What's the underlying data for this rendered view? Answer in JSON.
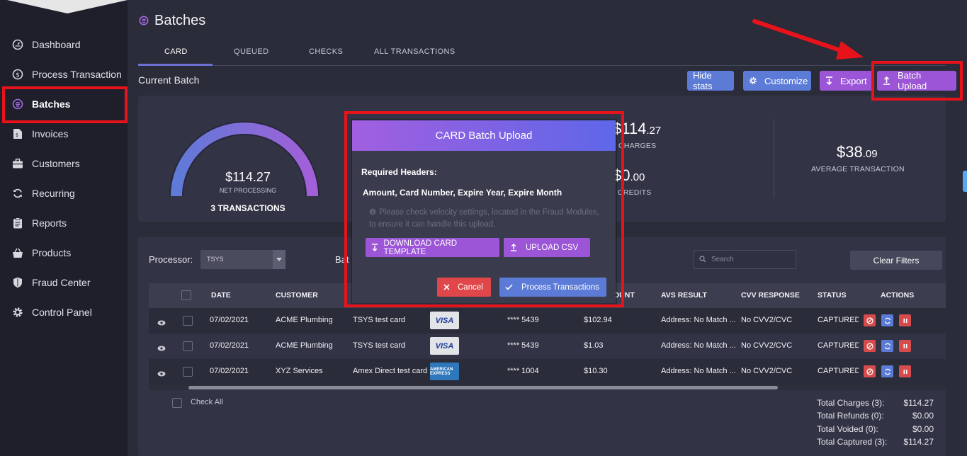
{
  "sidebar": {
    "items": [
      {
        "label": "Dashboard",
        "icon": "dashboard-gauge-icon"
      },
      {
        "label": "Process Transaction",
        "icon": "dollar-circle-icon"
      },
      {
        "label": "Batches",
        "icon": "batches-icon"
      },
      {
        "label": "Invoices",
        "icon": "invoice-icon"
      },
      {
        "label": "Customers",
        "icon": "briefcase-icon"
      },
      {
        "label": "Recurring",
        "icon": "recurring-sync-icon"
      },
      {
        "label": "Reports",
        "icon": "clipboard-icon"
      },
      {
        "label": "Products",
        "icon": "shopping-basket-icon"
      },
      {
        "label": "Fraud Center",
        "icon": "shield-icon"
      },
      {
        "label": "Control Panel",
        "icon": "gear-icon"
      }
    ],
    "active": "Batches"
  },
  "page": {
    "title": "Batches",
    "tabs": [
      "CARD",
      "QUEUED",
      "CHECKS",
      "ALL TRANSACTIONS"
    ],
    "active_tab": "CARD",
    "section_title": "Current Batch"
  },
  "toolbar": {
    "hide_stats": "Hide stats",
    "customize": "Customize",
    "export": "Export",
    "batch_upload": "Batch Upload"
  },
  "stats": {
    "gauge_amount": "$114.27",
    "gauge_label": "NET PROCESSING",
    "gauge_fill": 1.0,
    "transactions": "3 TRANSACTIONS",
    "charges_int": "$114",
    "charges_dec": ".27",
    "charges_label": "CHARGES",
    "credits_int": "$0",
    "credits_dec": ".00",
    "credits_label": "CREDITS",
    "avg_int": "$38",
    "avg_dec": ".09",
    "avg_label": "AVERAGE TRANSACTION"
  },
  "filters": {
    "processor_label": "Processor:",
    "processor_value": "TSYS",
    "batch_label": "Bat",
    "search_placeholder": "Search",
    "clear_filters": "Clear Filters"
  },
  "table": {
    "headers": {
      "date": "DATE",
      "customer": "CUSTOMER",
      "amount": "OUNT",
      "avs": "AVS RESULT",
      "cvv": "CVV RESPONSE",
      "status": "STATUS",
      "actions": "ACTIONS"
    },
    "rows": [
      {
        "date": "07/02/2021",
        "customer": "ACME Plumbing",
        "description": "TSYS test card",
        "brand": "VISA",
        "card": "**** 5439",
        "amount": "$102.94",
        "avs": "Address: No Match ...",
        "cvv": "No CVV2/CVC",
        "status": "CAPTURED"
      },
      {
        "date": "07/02/2021",
        "customer": "ACME Plumbing",
        "description": "TSYS test card",
        "brand": "VISA",
        "card": "**** 5439",
        "amount": "$1.03",
        "avs": "Address: No Match ...",
        "cvv": "No CVV2/CVC",
        "status": "CAPTURED"
      },
      {
        "date": "07/02/2021",
        "customer": "XYZ Services",
        "description": "Amex Direct test card",
        "brand": "AMERICAN EXPRESS",
        "card": "**** 1004",
        "amount": "$10.30",
        "avs": "Address: No Match ...",
        "cvv": "No CVV2/CVC",
        "status": "CAPTURED"
      }
    ],
    "check_all": "Check All"
  },
  "totals": [
    {
      "label": "Total Charges (3):",
      "value": "$114.27"
    },
    {
      "label": "Total Refunds (0):",
      "value": "$0.00"
    },
    {
      "label": "Total Voided (0):",
      "value": "$0.00"
    },
    {
      "label": "Total Captured (3):",
      "value": "$114.27"
    }
  ],
  "modal": {
    "title": "CARD Batch Upload",
    "required_label": "Required Headers:",
    "headers_list": "Amount, Card Number, Expire Year, Expire Month",
    "note": "Please check velocity settings, located in the Fraud Modules, to ensure it can handle this upload.",
    "download_button": "DOWNLOAD CARD TEMPLATE",
    "upload_button": "UPLOAD CSV",
    "cancel_button": "Cancel",
    "process_button": "Process Transactions"
  },
  "colors": {
    "highlight": "#e8131a",
    "accent_blue": "#5b7bd6",
    "accent_purple": "#9b55d6",
    "danger": "#d64c4c",
    "sidebar_bg": "#1e1f2b",
    "main_bg": "#2b2c39"
  }
}
